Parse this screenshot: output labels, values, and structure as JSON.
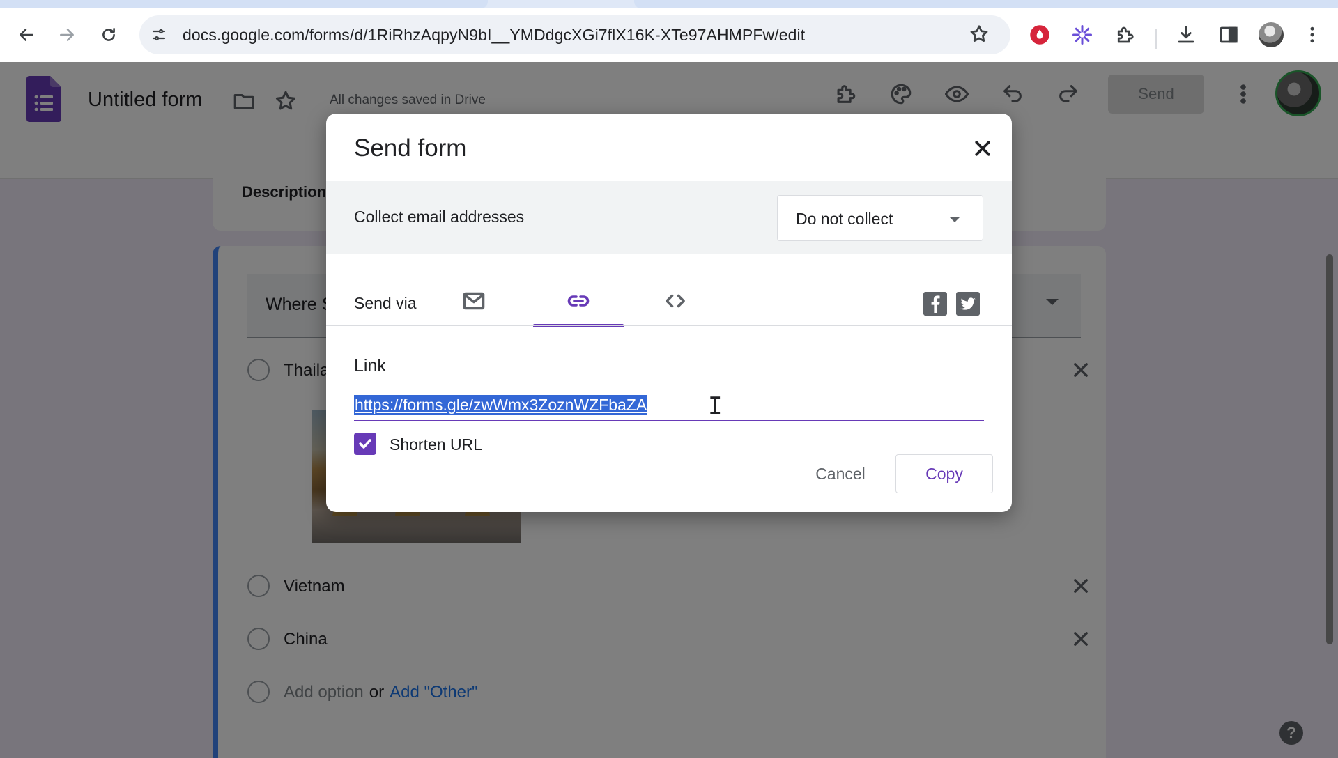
{
  "browser": {
    "url": "docs.google.com/forms/d/1RiRhzAqpyN9bI__YMDdgcXGi7flX16K-XTe97AHMPFw/edit",
    "icons": [
      "back-icon",
      "forward-icon",
      "reload-icon",
      "site-info-icon",
      "bookmark-star-icon",
      "extension-red-icon",
      "extension-purple-icon",
      "extensions-puzzle-icon",
      "download-icon",
      "side-panel-icon",
      "profile-avatar",
      "browser-menu-icon"
    ]
  },
  "forms_header": {
    "title": "Untitled form",
    "saved_status": "All changes saved in Drive",
    "send_label": "Send"
  },
  "form": {
    "description_label": "Description",
    "question_title": "Where S",
    "options": [
      {
        "label": "Thailan"
      },
      {
        "label": "Vietnam"
      },
      {
        "label": "China"
      }
    ],
    "add_option": "Add option",
    "or": "or",
    "add_other": "Add \"Other\"",
    "help": "?"
  },
  "dialog": {
    "title": "Send form",
    "collect_label": "Collect email addresses",
    "collect_value": "Do not collect",
    "send_via_label": "Send via",
    "active_tab": "link",
    "link_heading": "Link",
    "link_url": "https://forms.gle/zwWmx3ZoznWZFbaZA",
    "shorten_url_label": "Shorten URL",
    "shorten_url_checked": true,
    "cancel_label": "Cancel",
    "copy_label": "Copy"
  },
  "colors": {
    "accent": "#673ab7",
    "selection": "#3367d6",
    "form_bg": "#f0ebf8",
    "question_bar": "#4285f4"
  }
}
